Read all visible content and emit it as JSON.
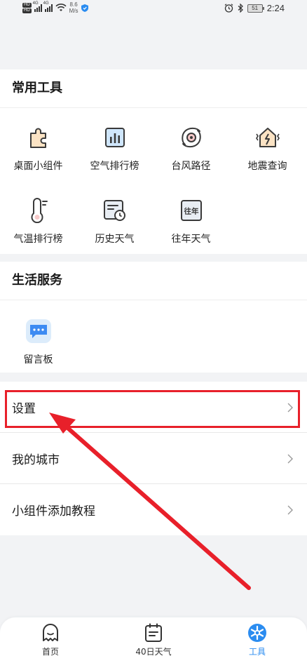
{
  "status_bar": {
    "hd1": "HD",
    "hd2": "HD",
    "net1": "4G",
    "net2": "4G",
    "speed_value": "8.6",
    "speed_unit": "M/s",
    "battery": "51",
    "time": "2:24"
  },
  "common_tools": {
    "title": "常用工具",
    "items": [
      {
        "label": "桌面小组件",
        "icon": "puzzle-icon"
      },
      {
        "label": "空气排行榜",
        "icon": "bar-chart-icon"
      },
      {
        "label": "台风路径",
        "icon": "typhoon-icon"
      },
      {
        "label": "地震查询",
        "icon": "earthquake-icon"
      },
      {
        "label": "气温排行榜",
        "icon": "thermometer-icon"
      },
      {
        "label": "历史天气",
        "icon": "history-calendar-icon"
      },
      {
        "label": "往年天气",
        "icon": "past-years-icon"
      }
    ],
    "past_icon_text": "往年"
  },
  "life_services": {
    "title": "生活服务",
    "items": [
      {
        "label": "留言板",
        "icon": "message-board-icon"
      }
    ]
  },
  "menu_rows": [
    {
      "label": "设置"
    },
    {
      "label": "我的城市"
    },
    {
      "label": "小组件添加教程"
    }
  ],
  "tabbar": {
    "tabs": [
      {
        "label": "首页",
        "icon": "home-ghost-icon"
      },
      {
        "label": "40日天气",
        "icon": "calendar-icon"
      },
      {
        "label": "工具",
        "icon": "tools-icon",
        "active": true
      }
    ]
  },
  "colors": {
    "accent": "#2b8cf0",
    "highlight": "#e8202a",
    "background": "#f2f3f5"
  }
}
